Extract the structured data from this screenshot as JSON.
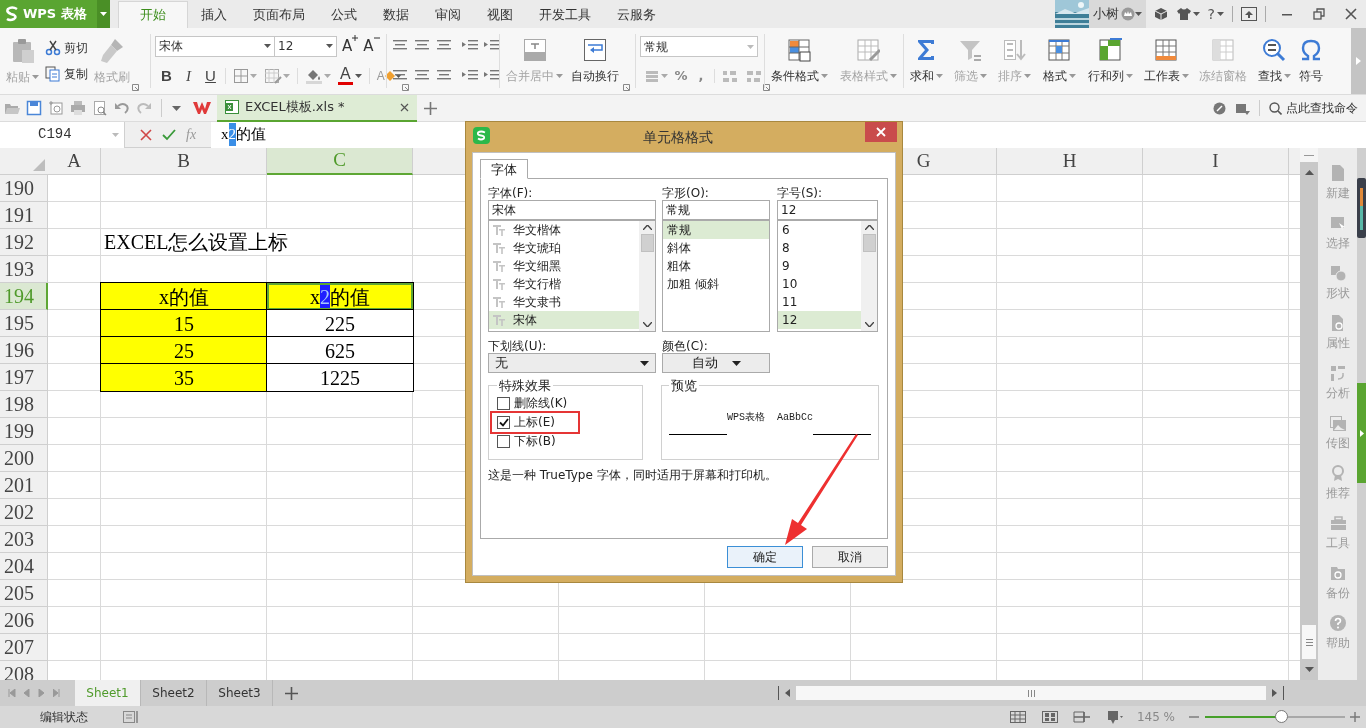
{
  "app": {
    "logo_text": "WPS 表格"
  },
  "menu_tabs": [
    {
      "label": "开始",
      "selected": true
    },
    {
      "label": "插入",
      "selected": false
    },
    {
      "label": "页面布局",
      "selected": false
    },
    {
      "label": "公式",
      "selected": false
    },
    {
      "label": "数据",
      "selected": false
    },
    {
      "label": "审阅",
      "selected": false
    },
    {
      "label": "视图",
      "selected": false
    },
    {
      "label": "开发工具",
      "selected": false
    },
    {
      "label": "云服务",
      "selected": false
    }
  ],
  "account": {
    "name": "小树",
    "help": "?"
  },
  "ribbon": {
    "clipboard": [
      {
        "kind": "large",
        "label": "粘贴",
        "disabled": true,
        "menu": true
      },
      {
        "kind": "small",
        "label": "剪切",
        "disabled": false,
        "menu": false
      },
      {
        "kind": "small",
        "label": "复制",
        "disabled": false,
        "menu": false
      },
      {
        "kind": "large",
        "label": "格式刷",
        "disabled": true,
        "menu": false
      }
    ],
    "font_name": "宋体",
    "font_size": "12",
    "size_buttons": [
      "A",
      "A"
    ],
    "style_buttons": [
      "B",
      "I",
      "U"
    ],
    "font_color_button": "A",
    "clear_button": "A",
    "alignment_buttons": [
      {
        "label": "合并居中",
        "disabled": true,
        "menu": true
      },
      {
        "label": "自动换行",
        "disabled": false,
        "menu": false
      }
    ],
    "number_format": "常规",
    "number_buttons": [
      "%",
      ","
    ],
    "tools": [
      {
        "label": "条件格式",
        "disabled": false,
        "menu": true
      },
      {
        "label": "表格样式",
        "disabled": true,
        "menu": true
      },
      {
        "label": "求和",
        "disabled": false,
        "menu": true
      },
      {
        "label": "筛选",
        "disabled": true,
        "menu": true
      },
      {
        "label": "排序",
        "disabled": true,
        "menu": true
      },
      {
        "label": "格式",
        "disabled": false,
        "menu": true
      },
      {
        "label": "行和列",
        "disabled": false,
        "menu": true
      },
      {
        "label": "工作表",
        "disabled": false,
        "menu": true
      },
      {
        "label": "冻结窗格",
        "disabled": true,
        "menu": false
      },
      {
        "label": "查找",
        "disabled": false,
        "menu": true
      },
      {
        "label": "符号",
        "disabled": false,
        "menu": false
      }
    ]
  },
  "document_tab": {
    "title": "EXCEL模板.xls *"
  },
  "command_search": "点此查找命令",
  "formula_bar": {
    "cell": "C194",
    "fx": "fx",
    "segments": [
      {
        "text": "x",
        "selected": false
      },
      {
        "text": "2",
        "selected": true
      },
      {
        "text": "的值",
        "selected": false
      }
    ]
  },
  "columns": [
    {
      "label": "A",
      "selected": false
    },
    {
      "label": "B",
      "selected": false
    },
    {
      "label": "C",
      "selected": true
    },
    {
      "label": "G",
      "selected": false
    },
    {
      "label": "H",
      "selected": false
    },
    {
      "label": "I",
      "selected": false
    }
  ],
  "rows": [
    {
      "header": "190",
      "selected": false
    },
    {
      "header": "191",
      "selected": false
    },
    {
      "header": "192",
      "selected": false,
      "B": {
        "text": "EXCEL怎么设置上标",
        "spills": true
      }
    },
    {
      "header": "193",
      "selected": false
    },
    {
      "header": "194",
      "selected": true,
      "B": {
        "text": "x的值",
        "color": "#ffff00",
        "bordered": true,
        "selected": false
      },
      "C": {
        "segments": [
          {
            "text": "x",
            "selected": false
          },
          {
            "text": "2",
            "selected": true
          },
          {
            "text": "的值",
            "selected": false
          }
        ],
        "color": "#ffff00",
        "bordered": true,
        "selected": true
      }
    },
    {
      "header": "195",
      "selected": false,
      "B": {
        "text": "15",
        "color": "#ffff00",
        "bordered": true,
        "selected": false
      },
      "C": {
        "text": "225",
        "bordered": true,
        "selected": false
      }
    },
    {
      "header": "196",
      "selected": false,
      "B": {
        "text": "25",
        "color": "#ffff00",
        "bordered": true,
        "selected": false
      },
      "C": {
        "text": "625",
        "bordered": true,
        "selected": false
      }
    },
    {
      "header": "197",
      "selected": false,
      "B": {
        "text": "35",
        "color": "#ffff00",
        "bordered": true,
        "selected": false
      },
      "C": {
        "text": "1225",
        "bordered": true,
        "selected": false
      }
    },
    {
      "header": "198",
      "selected": false
    },
    {
      "header": "199",
      "selected": false
    },
    {
      "header": "200",
      "selected": false
    },
    {
      "header": "201",
      "selected": false
    },
    {
      "header": "202",
      "selected": false
    },
    {
      "header": "203",
      "selected": false
    },
    {
      "header": "204",
      "selected": false
    },
    {
      "header": "205",
      "selected": false
    },
    {
      "header": "206",
      "selected": false
    },
    {
      "header": "207",
      "selected": false
    },
    {
      "header": "208",
      "selected": false
    }
  ],
  "side_panel": [
    "新建",
    "选择",
    "形状",
    "属性",
    "分析",
    "传图",
    "推荐",
    "工具",
    "备份",
    "帮助"
  ],
  "sheets": [
    {
      "label": "Sheet1",
      "selected": true
    },
    {
      "label": "Sheet2",
      "selected": false
    },
    {
      "label": "Sheet3",
      "selected": false
    }
  ],
  "status": {
    "mode": "编辑状态",
    "zoom": {
      "reading": "145 %",
      "level": 0.54
    }
  },
  "dialog": {
    "title": "单元格格式",
    "tabs": [
      {
        "label": "字体",
        "selected": true
      }
    ],
    "font": {
      "label": "字体(F):",
      "value": "宋体",
      "options": [
        {
          "label": "华文楷体",
          "selected": false
        },
        {
          "label": "华文琥珀",
          "selected": false
        },
        {
          "label": "华文细黑",
          "selected": false
        },
        {
          "label": "华文行楷",
          "selected": false
        },
        {
          "label": "华文隶书",
          "selected": false
        },
        {
          "label": "宋体",
          "selected": true
        }
      ]
    },
    "style": {
      "label": "字形(O):",
      "value": "常规",
      "options": [
        {
          "label": "常规",
          "selected": true
        },
        {
          "label": "斜体",
          "selected": false
        },
        {
          "label": "粗体",
          "selected": false
        },
        {
          "label": "加粗 倾斜",
          "selected": false
        }
      ]
    },
    "size": {
      "label": "字号(S):",
      "value": "12",
      "options": [
        {
          "label": "6",
          "selected": false
        },
        {
          "label": "8",
          "selected": false
        },
        {
          "label": "9",
          "selected": false
        },
        {
          "label": "10",
          "selected": false
        },
        {
          "label": "11",
          "selected": false
        },
        {
          "label": "12",
          "selected": true
        }
      ]
    },
    "underline": {
      "label": "下划线(U):",
      "value": "无"
    },
    "color": {
      "label": "颜色(C):",
      "value": "自动"
    },
    "effects": {
      "label": "特殊效果",
      "options": [
        {
          "label": "删除线(K)",
          "checked": false,
          "highlighted": false
        },
        {
          "label": "上标(E)",
          "checked": true,
          "highlighted": true
        },
        {
          "label": "下标(B)",
          "checked": false,
          "highlighted": false
        }
      ]
    },
    "preview": {
      "label": "预览",
      "samples": [
        "WPS表格",
        "AaBbCc"
      ]
    },
    "note": "这是一种 TrueType 字体，同时适用于屏幕和打印机。",
    "buttons": [
      {
        "label": "确定",
        "kind": "primary"
      },
      {
        "label": "取消",
        "kind": "secondary"
      }
    ]
  }
}
